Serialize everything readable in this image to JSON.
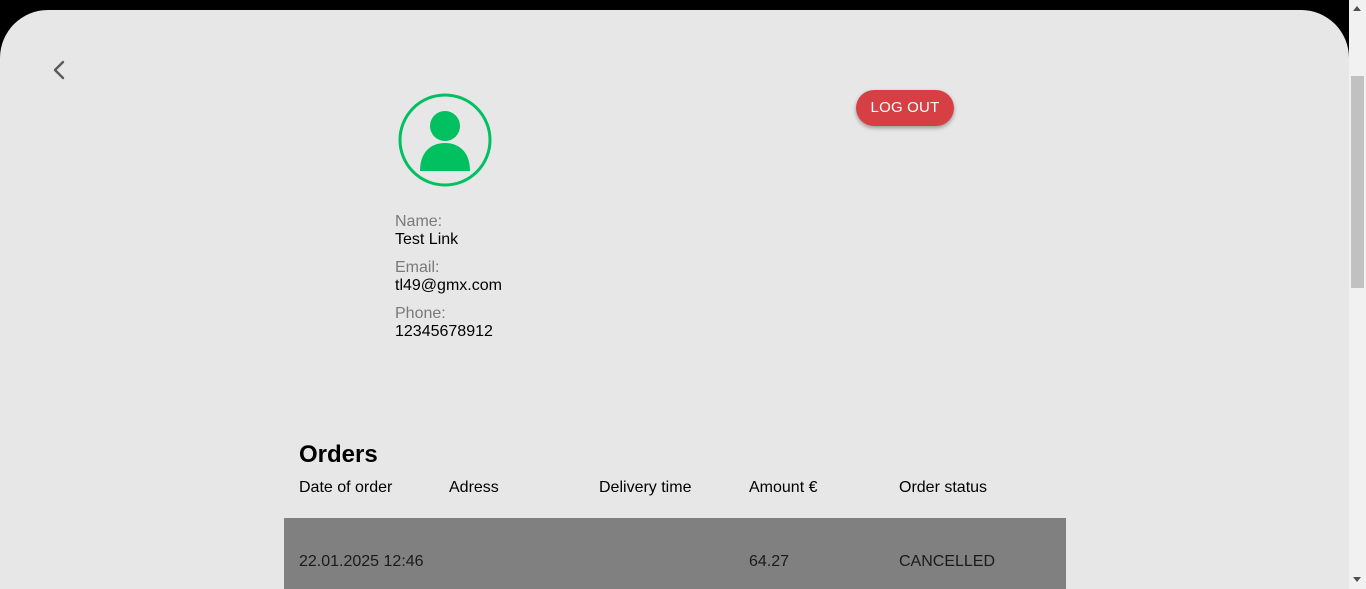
{
  "colors": {
    "page_background": "#e7e7e7",
    "accent_green": "#00c060",
    "logout_red": "#d64045",
    "row_gray": "#808080"
  },
  "nav": {
    "back_icon": "chevron-left-icon"
  },
  "profile": {
    "avatar_icon": "user-avatar-icon",
    "logout_label": "LOG OUT",
    "name_label": "Name:",
    "name_value": "Test Link",
    "email_label": "Email:",
    "email_value": "tl49@gmx.com",
    "phone_label": "Phone:",
    "phone_value": "12345678912"
  },
  "orders": {
    "title": "Orders",
    "columns": [
      "Date of order",
      "Adress",
      "Delivery time",
      "Amount €",
      "Order status"
    ],
    "rows": [
      {
        "date": "22.01.2025 12:46",
        "address": "",
        "delivery_time": "",
        "amount": "64.27",
        "status": "CANCELLED"
      }
    ]
  }
}
